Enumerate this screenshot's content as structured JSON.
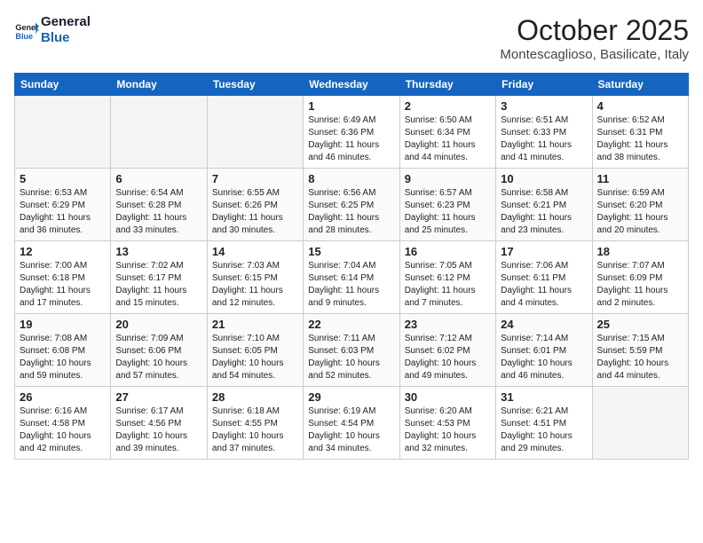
{
  "header": {
    "logo_line1": "General",
    "logo_line2": "Blue",
    "month": "October 2025",
    "location": "Montescaglioso, Basilicate, Italy"
  },
  "weekdays": [
    "Sunday",
    "Monday",
    "Tuesday",
    "Wednesday",
    "Thursday",
    "Friday",
    "Saturday"
  ],
  "weeks": [
    [
      {
        "day": "",
        "info": ""
      },
      {
        "day": "",
        "info": ""
      },
      {
        "day": "",
        "info": ""
      },
      {
        "day": "1",
        "info": "Sunrise: 6:49 AM\nSunset: 6:36 PM\nDaylight: 11 hours\nand 46 minutes."
      },
      {
        "day": "2",
        "info": "Sunrise: 6:50 AM\nSunset: 6:34 PM\nDaylight: 11 hours\nand 44 minutes."
      },
      {
        "day": "3",
        "info": "Sunrise: 6:51 AM\nSunset: 6:33 PM\nDaylight: 11 hours\nand 41 minutes."
      },
      {
        "day": "4",
        "info": "Sunrise: 6:52 AM\nSunset: 6:31 PM\nDaylight: 11 hours\nand 38 minutes."
      }
    ],
    [
      {
        "day": "5",
        "info": "Sunrise: 6:53 AM\nSunset: 6:29 PM\nDaylight: 11 hours\nand 36 minutes."
      },
      {
        "day": "6",
        "info": "Sunrise: 6:54 AM\nSunset: 6:28 PM\nDaylight: 11 hours\nand 33 minutes."
      },
      {
        "day": "7",
        "info": "Sunrise: 6:55 AM\nSunset: 6:26 PM\nDaylight: 11 hours\nand 30 minutes."
      },
      {
        "day": "8",
        "info": "Sunrise: 6:56 AM\nSunset: 6:25 PM\nDaylight: 11 hours\nand 28 minutes."
      },
      {
        "day": "9",
        "info": "Sunrise: 6:57 AM\nSunset: 6:23 PM\nDaylight: 11 hours\nand 25 minutes."
      },
      {
        "day": "10",
        "info": "Sunrise: 6:58 AM\nSunset: 6:21 PM\nDaylight: 11 hours\nand 23 minutes."
      },
      {
        "day": "11",
        "info": "Sunrise: 6:59 AM\nSunset: 6:20 PM\nDaylight: 11 hours\nand 20 minutes."
      }
    ],
    [
      {
        "day": "12",
        "info": "Sunrise: 7:00 AM\nSunset: 6:18 PM\nDaylight: 11 hours\nand 17 minutes."
      },
      {
        "day": "13",
        "info": "Sunrise: 7:02 AM\nSunset: 6:17 PM\nDaylight: 11 hours\nand 15 minutes."
      },
      {
        "day": "14",
        "info": "Sunrise: 7:03 AM\nSunset: 6:15 PM\nDaylight: 11 hours\nand 12 minutes."
      },
      {
        "day": "15",
        "info": "Sunrise: 7:04 AM\nSunset: 6:14 PM\nDaylight: 11 hours\nand 9 minutes."
      },
      {
        "day": "16",
        "info": "Sunrise: 7:05 AM\nSunset: 6:12 PM\nDaylight: 11 hours\nand 7 minutes."
      },
      {
        "day": "17",
        "info": "Sunrise: 7:06 AM\nSunset: 6:11 PM\nDaylight: 11 hours\nand 4 minutes."
      },
      {
        "day": "18",
        "info": "Sunrise: 7:07 AM\nSunset: 6:09 PM\nDaylight: 11 hours\nand 2 minutes."
      }
    ],
    [
      {
        "day": "19",
        "info": "Sunrise: 7:08 AM\nSunset: 6:08 PM\nDaylight: 10 hours\nand 59 minutes."
      },
      {
        "day": "20",
        "info": "Sunrise: 7:09 AM\nSunset: 6:06 PM\nDaylight: 10 hours\nand 57 minutes."
      },
      {
        "day": "21",
        "info": "Sunrise: 7:10 AM\nSunset: 6:05 PM\nDaylight: 10 hours\nand 54 minutes."
      },
      {
        "day": "22",
        "info": "Sunrise: 7:11 AM\nSunset: 6:03 PM\nDaylight: 10 hours\nand 52 minutes."
      },
      {
        "day": "23",
        "info": "Sunrise: 7:12 AM\nSunset: 6:02 PM\nDaylight: 10 hours\nand 49 minutes."
      },
      {
        "day": "24",
        "info": "Sunrise: 7:14 AM\nSunset: 6:01 PM\nDaylight: 10 hours\nand 46 minutes."
      },
      {
        "day": "25",
        "info": "Sunrise: 7:15 AM\nSunset: 5:59 PM\nDaylight: 10 hours\nand 44 minutes."
      }
    ],
    [
      {
        "day": "26",
        "info": "Sunrise: 6:16 AM\nSunset: 4:58 PM\nDaylight: 10 hours\nand 42 minutes."
      },
      {
        "day": "27",
        "info": "Sunrise: 6:17 AM\nSunset: 4:56 PM\nDaylight: 10 hours\nand 39 minutes."
      },
      {
        "day": "28",
        "info": "Sunrise: 6:18 AM\nSunset: 4:55 PM\nDaylight: 10 hours\nand 37 minutes."
      },
      {
        "day": "29",
        "info": "Sunrise: 6:19 AM\nSunset: 4:54 PM\nDaylight: 10 hours\nand 34 minutes."
      },
      {
        "day": "30",
        "info": "Sunrise: 6:20 AM\nSunset: 4:53 PM\nDaylight: 10 hours\nand 32 minutes."
      },
      {
        "day": "31",
        "info": "Sunrise: 6:21 AM\nSunset: 4:51 PM\nDaylight: 10 hours\nand 29 minutes."
      },
      {
        "day": "",
        "info": ""
      }
    ]
  ]
}
